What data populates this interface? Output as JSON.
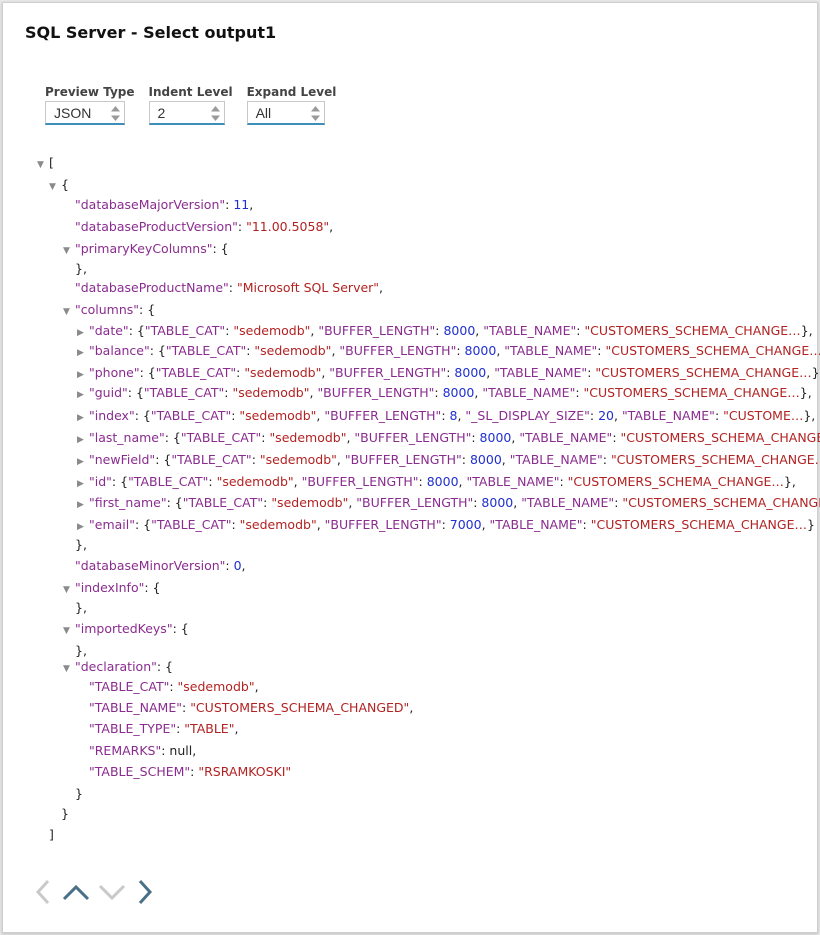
{
  "dialog": {
    "title": "SQL Server - Select output1"
  },
  "controls": {
    "preview_type": {
      "label": "Preview Type",
      "value": "JSON"
    },
    "indent_level": {
      "label": "Indent Level",
      "value": "2"
    },
    "expand_level": {
      "label": "Expand Level",
      "value": "All"
    }
  },
  "colors": {
    "key": "#8a2c8f",
    "string": "#b22222",
    "number": "#1f2fd0",
    "accent": "#3d8eb9"
  },
  "json_lines": [
    [
      {
        "t": "p",
        "v": "["
      }
    ],
    [
      {
        "t": "p",
        "v": "{"
      }
    ],
    [
      {
        "t": "k",
        "v": "\"databaseMajorVersion\""
      },
      {
        "t": "p",
        "v": ":  "
      },
      {
        "t": "n",
        "v": "11"
      },
      {
        "t": "p",
        "v": ","
      }
    ],
    [
      {
        "t": "k",
        "v": "\"databaseProductVersion\""
      },
      {
        "t": "p",
        "v": ":  "
      },
      {
        "t": "s",
        "v": "\"11.00.5058\""
      },
      {
        "t": "p",
        "v": ","
      }
    ],
    [
      {
        "t": "k",
        "v": "\"primaryKeyColumns\""
      },
      {
        "t": "p",
        "v": ":  {"
      }
    ],
    [
      {
        "t": "p",
        "v": "},"
      }
    ],
    [
      {
        "t": "k",
        "v": "\"databaseProductName\""
      },
      {
        "t": "p",
        "v": ":  "
      },
      {
        "t": "s",
        "v": "\"Microsoft SQL Server\""
      },
      {
        "t": "p",
        "v": ","
      }
    ],
    [
      {
        "t": "k",
        "v": "\"columns\""
      },
      {
        "t": "p",
        "v": ":  {"
      }
    ],
    [
      {
        "t": "k",
        "v": "\"date\""
      },
      {
        "t": "p",
        "v": ":  {"
      },
      {
        "t": "k",
        "v": "\"TABLE_CAT\""
      },
      {
        "t": "p",
        "v": ":  "
      },
      {
        "t": "s",
        "v": "\"sedemodb\""
      },
      {
        "t": "p",
        "v": ", "
      },
      {
        "t": "k",
        "v": "\"BUFFER_LENGTH\""
      },
      {
        "t": "p",
        "v": ":  "
      },
      {
        "t": "n",
        "v": "8000"
      },
      {
        "t": "p",
        "v": ", "
      },
      {
        "t": "k",
        "v": "\"TABLE_NAME\""
      },
      {
        "t": "p",
        "v": ":  "
      },
      {
        "t": "s",
        "v": "\"CUSTOMERS_SCHEMA_CHANGE…"
      },
      {
        "t": "p",
        "v": "},"
      }
    ],
    [
      {
        "t": "k",
        "v": "\"balance\""
      },
      {
        "t": "p",
        "v": ":  {"
      },
      {
        "t": "k",
        "v": "\"TABLE_CAT\""
      },
      {
        "t": "p",
        "v": ":  "
      },
      {
        "t": "s",
        "v": "\"sedemodb\""
      },
      {
        "t": "p",
        "v": ", "
      },
      {
        "t": "k",
        "v": "\"BUFFER_LENGTH\""
      },
      {
        "t": "p",
        "v": ":  "
      },
      {
        "t": "n",
        "v": "8000"
      },
      {
        "t": "p",
        "v": ", "
      },
      {
        "t": "k",
        "v": "\"TABLE_NAME\""
      },
      {
        "t": "p",
        "v": ":  "
      },
      {
        "t": "s",
        "v": "\"CUSTOMERS_SCHEMA_CHANGE…"
      },
      {
        "t": "p",
        "v": "},"
      }
    ],
    [
      {
        "t": "k",
        "v": "\"phone\""
      },
      {
        "t": "p",
        "v": ":  {"
      },
      {
        "t": "k",
        "v": "\"TABLE_CAT\""
      },
      {
        "t": "p",
        "v": ":  "
      },
      {
        "t": "s",
        "v": "\"sedemodb\""
      },
      {
        "t": "p",
        "v": ", "
      },
      {
        "t": "k",
        "v": "\"BUFFER_LENGTH\""
      },
      {
        "t": "p",
        "v": ":  "
      },
      {
        "t": "n",
        "v": "8000"
      },
      {
        "t": "p",
        "v": ", "
      },
      {
        "t": "k",
        "v": "\"TABLE_NAME\""
      },
      {
        "t": "p",
        "v": ":  "
      },
      {
        "t": "s",
        "v": "\"CUSTOMERS_SCHEMA_CHANGE…"
      },
      {
        "t": "p",
        "v": "},"
      }
    ],
    [
      {
        "t": "k",
        "v": "\"guid\""
      },
      {
        "t": "p",
        "v": ":  {"
      },
      {
        "t": "k",
        "v": "\"TABLE_CAT\""
      },
      {
        "t": "p",
        "v": ":  "
      },
      {
        "t": "s",
        "v": "\"sedemodb\""
      },
      {
        "t": "p",
        "v": ", "
      },
      {
        "t": "k",
        "v": "\"BUFFER_LENGTH\""
      },
      {
        "t": "p",
        "v": ":  "
      },
      {
        "t": "n",
        "v": "8000"
      },
      {
        "t": "p",
        "v": ", "
      },
      {
        "t": "k",
        "v": "\"TABLE_NAME\""
      },
      {
        "t": "p",
        "v": ":  "
      },
      {
        "t": "s",
        "v": "\"CUSTOMERS_SCHEMA_CHANGE…"
      },
      {
        "t": "p",
        "v": "},"
      }
    ],
    [
      {
        "t": "k",
        "v": "\"index\""
      },
      {
        "t": "p",
        "v": ":  {"
      },
      {
        "t": "k",
        "v": "\"TABLE_CAT\""
      },
      {
        "t": "p",
        "v": ":  "
      },
      {
        "t": "s",
        "v": "\"sedemodb\""
      },
      {
        "t": "p",
        "v": ", "
      },
      {
        "t": "k",
        "v": "\"BUFFER_LENGTH\""
      },
      {
        "t": "p",
        "v": ":  "
      },
      {
        "t": "n",
        "v": "8"
      },
      {
        "t": "p",
        "v": ", "
      },
      {
        "t": "k",
        "v": "\"_SL_DISPLAY_SIZE\""
      },
      {
        "t": "p",
        "v": ":  "
      },
      {
        "t": "n",
        "v": "20"
      },
      {
        "t": "p",
        "v": ", "
      },
      {
        "t": "k",
        "v": "\"TABLE_NAME\""
      },
      {
        "t": "p",
        "v": ":  "
      },
      {
        "t": "s",
        "v": "\"CUSTOME…"
      },
      {
        "t": "p",
        "v": "},"
      }
    ],
    [
      {
        "t": "k",
        "v": "\"last_name\""
      },
      {
        "t": "p",
        "v": ":  {"
      },
      {
        "t": "k",
        "v": "\"TABLE_CAT\""
      },
      {
        "t": "p",
        "v": ":  "
      },
      {
        "t": "s",
        "v": "\"sedemodb\""
      },
      {
        "t": "p",
        "v": ", "
      },
      {
        "t": "k",
        "v": "\"BUFFER_LENGTH\""
      },
      {
        "t": "p",
        "v": ":  "
      },
      {
        "t": "n",
        "v": "8000"
      },
      {
        "t": "p",
        "v": ", "
      },
      {
        "t": "k",
        "v": "\"TABLE_NAME\""
      },
      {
        "t": "p",
        "v": ":  "
      },
      {
        "t": "s",
        "v": "\"CUSTOMERS_SCHEMA_CHANGE…"
      },
      {
        "t": "p",
        "v": "},"
      }
    ],
    [
      {
        "t": "k",
        "v": "\"newField\""
      },
      {
        "t": "p",
        "v": ":  {"
      },
      {
        "t": "k",
        "v": "\"TABLE_CAT\""
      },
      {
        "t": "p",
        "v": ":  "
      },
      {
        "t": "s",
        "v": "\"sedemodb\""
      },
      {
        "t": "p",
        "v": ", "
      },
      {
        "t": "k",
        "v": "\"BUFFER_LENGTH\""
      },
      {
        "t": "p",
        "v": ":  "
      },
      {
        "t": "n",
        "v": "8000"
      },
      {
        "t": "p",
        "v": ", "
      },
      {
        "t": "k",
        "v": "\"TABLE_NAME\""
      },
      {
        "t": "p",
        "v": ":  "
      },
      {
        "t": "s",
        "v": "\"CUSTOMERS_SCHEMA_CHANGE…"
      },
      {
        "t": "p",
        "v": "},"
      }
    ],
    [
      {
        "t": "k",
        "v": "\"id\""
      },
      {
        "t": "p",
        "v": ":  {"
      },
      {
        "t": "k",
        "v": "\"TABLE_CAT\""
      },
      {
        "t": "p",
        "v": ":  "
      },
      {
        "t": "s",
        "v": "\"sedemodb\""
      },
      {
        "t": "p",
        "v": ", "
      },
      {
        "t": "k",
        "v": "\"BUFFER_LENGTH\""
      },
      {
        "t": "p",
        "v": ":  "
      },
      {
        "t": "n",
        "v": "8000"
      },
      {
        "t": "p",
        "v": ", "
      },
      {
        "t": "k",
        "v": "\"TABLE_NAME\""
      },
      {
        "t": "p",
        "v": ":  "
      },
      {
        "t": "s",
        "v": "\"CUSTOMERS_SCHEMA_CHANGE…"
      },
      {
        "t": "p",
        "v": "},"
      }
    ],
    [
      {
        "t": "k",
        "v": "\"first_name\""
      },
      {
        "t": "p",
        "v": ":  {"
      },
      {
        "t": "k",
        "v": "\"TABLE_CAT\""
      },
      {
        "t": "p",
        "v": ":  "
      },
      {
        "t": "s",
        "v": "\"sedemodb\""
      },
      {
        "t": "p",
        "v": ", "
      },
      {
        "t": "k",
        "v": "\"BUFFER_LENGTH\""
      },
      {
        "t": "p",
        "v": ":  "
      },
      {
        "t": "n",
        "v": "8000"
      },
      {
        "t": "p",
        "v": ", "
      },
      {
        "t": "k",
        "v": "\"TABLE_NAME\""
      },
      {
        "t": "p",
        "v": ":  "
      },
      {
        "t": "s",
        "v": "\"CUSTOMERS_SCHEMA_CHANGE…"
      },
      {
        "t": "p",
        "v": "},"
      }
    ],
    [
      {
        "t": "k",
        "v": "\"email\""
      },
      {
        "t": "p",
        "v": ":  {"
      },
      {
        "t": "k",
        "v": "\"TABLE_CAT\""
      },
      {
        "t": "p",
        "v": ":  "
      },
      {
        "t": "s",
        "v": "\"sedemodb\""
      },
      {
        "t": "p",
        "v": ", "
      },
      {
        "t": "k",
        "v": "\"BUFFER_LENGTH\""
      },
      {
        "t": "p",
        "v": ":  "
      },
      {
        "t": "n",
        "v": "7000"
      },
      {
        "t": "p",
        "v": ", "
      },
      {
        "t": "k",
        "v": "\"TABLE_NAME\""
      },
      {
        "t": "p",
        "v": ":  "
      },
      {
        "t": "s",
        "v": "\"CUSTOMERS_SCHEMA_CHANGE…"
      },
      {
        "t": "p",
        "v": "}"
      }
    ],
    [
      {
        "t": "p",
        "v": "},"
      }
    ],
    [
      {
        "t": "k",
        "v": "\"databaseMinorVersion\""
      },
      {
        "t": "p",
        "v": ":  "
      },
      {
        "t": "n",
        "v": "0"
      },
      {
        "t": "p",
        "v": ","
      }
    ],
    [
      {
        "t": "k",
        "v": "\"indexInfo\""
      },
      {
        "t": "p",
        "v": ":  {"
      }
    ],
    [
      {
        "t": "p",
        "v": "},"
      }
    ],
    [
      {
        "t": "k",
        "v": "\"importedKeys\""
      },
      {
        "t": "p",
        "v": ":  {"
      }
    ],
    [
      {
        "t": "p",
        "v": "},"
      }
    ],
    [
      {
        "t": "k",
        "v": "\"declaration\""
      },
      {
        "t": "p",
        "v": ":  {"
      }
    ],
    [
      {
        "t": "k",
        "v": "\"TABLE_CAT\""
      },
      {
        "t": "p",
        "v": ":  "
      },
      {
        "t": "s",
        "v": "\"sedemodb\""
      },
      {
        "t": "p",
        "v": ","
      }
    ],
    [
      {
        "t": "k",
        "v": "\"TABLE_NAME\""
      },
      {
        "t": "p",
        "v": ":  "
      },
      {
        "t": "s",
        "v": "\"CUSTOMERS_SCHEMA_CHANGED\""
      },
      {
        "t": "p",
        "v": ","
      }
    ],
    [
      {
        "t": "k",
        "v": "\"TABLE_TYPE\""
      },
      {
        "t": "p",
        "v": ":  "
      },
      {
        "t": "s",
        "v": "\"TABLE\""
      },
      {
        "t": "p",
        "v": ","
      }
    ],
    [
      {
        "t": "k",
        "v": "\"REMARKS\""
      },
      {
        "t": "p",
        "v": ":  null,"
      }
    ],
    [
      {
        "t": "k",
        "v": "\"TABLE_SCHEM\""
      },
      {
        "t": "p",
        "v": ":  "
      },
      {
        "t": "s",
        "v": "\"RSRAMKOSKI\""
      }
    ],
    [
      {
        "t": "p",
        "v": "}"
      }
    ],
    [
      {
        "t": "p",
        "v": "}"
      }
    ],
    [
      {
        "t": "p",
        "v": "]"
      }
    ]
  ],
  "tree_state": [
    "expanded",
    "expanded",
    "",
    "",
    "expanded",
    "",
    "",
    "expanded",
    "collapsed",
    "collapsed",
    "collapsed",
    "collapsed",
    "collapsed",
    "collapsed",
    "collapsed",
    "collapsed",
    "collapsed",
    "collapsed",
    "",
    "",
    "expanded",
    "",
    "expanded",
    "",
    "expanded",
    "",
    "",
    "",
    "",
    "",
    "",
    "",
    ""
  ],
  "nav": {
    "prev_icon": "chevron-left-icon",
    "up_icon": "chevron-up-icon",
    "down_icon": "chevron-down-icon",
    "next_icon": "chevron-right-icon"
  }
}
